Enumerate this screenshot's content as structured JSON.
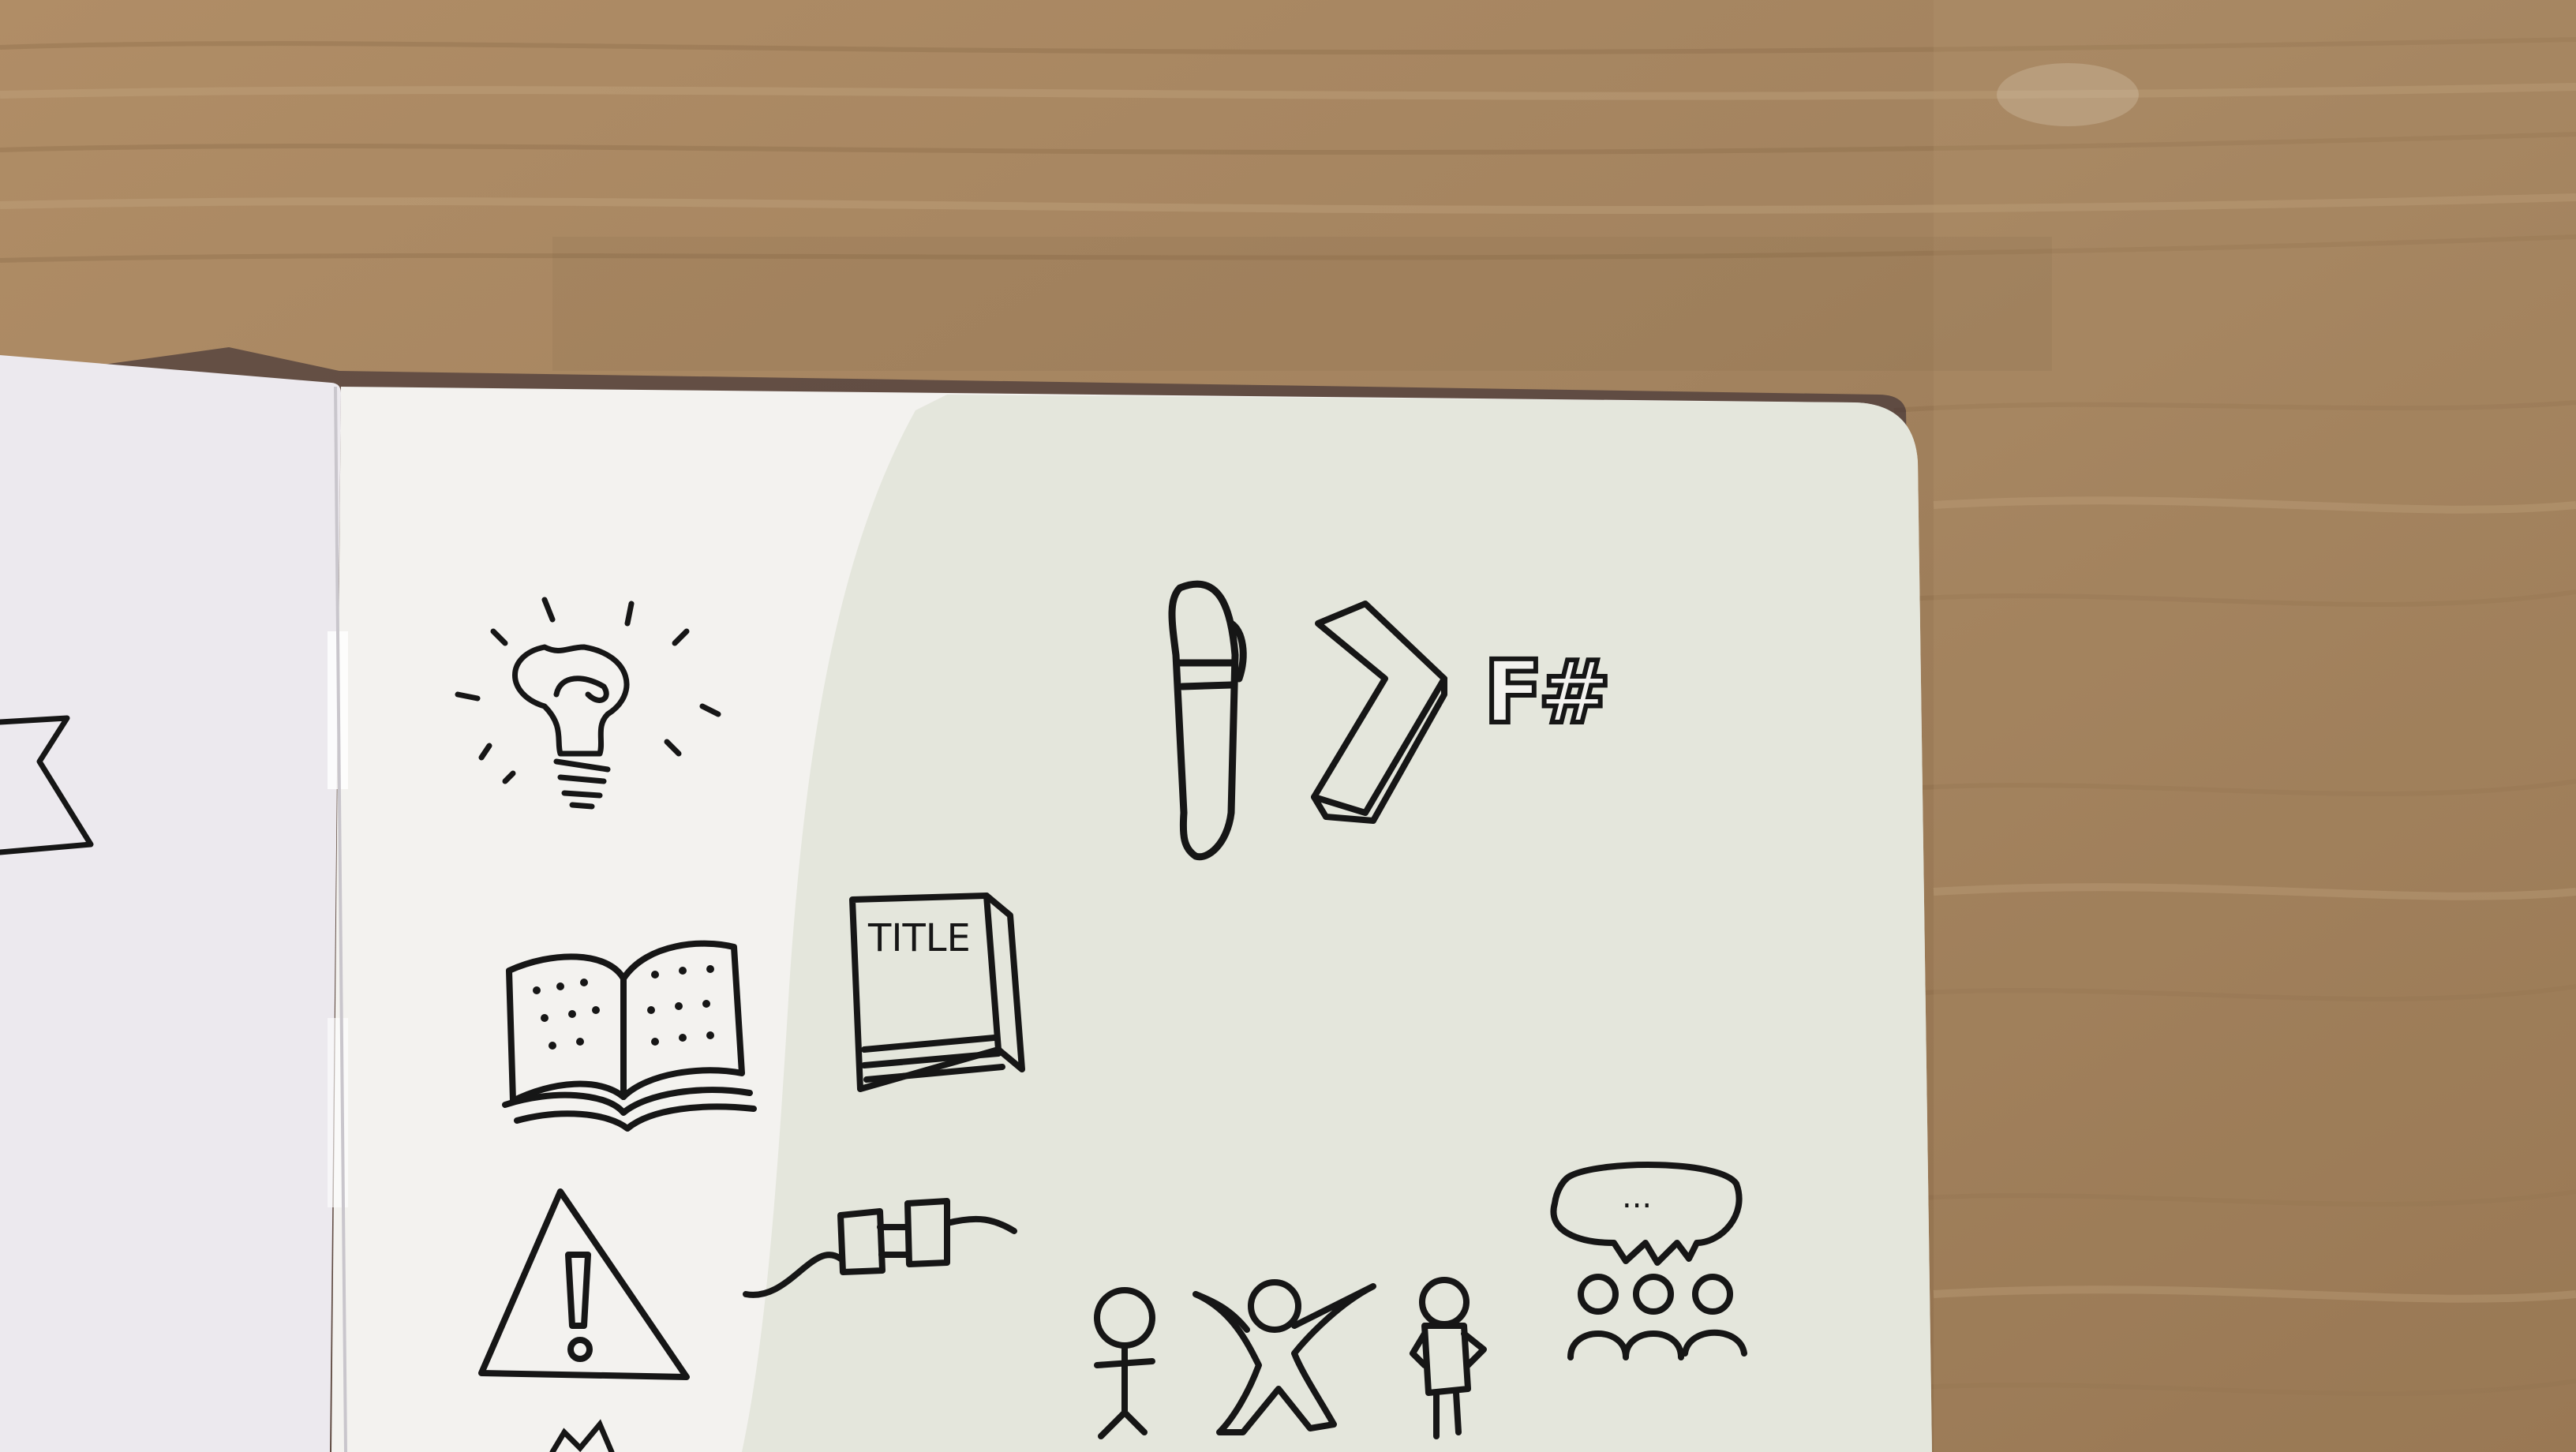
{
  "photo": {
    "subject": "notebook-sketches-on-wooden-table",
    "colors": {
      "wood_base": "#a3835f",
      "wood_light": "#c4a37e",
      "wood_dark": "#7e6140",
      "page": "#f3f2ef",
      "page_shadow": "#dfe1d6",
      "ink": "#161616"
    }
  },
  "sketches": {
    "book_title": "TITLE",
    "fsharp_logo_text": "F#",
    "speech_bubble_text": "..."
  }
}
